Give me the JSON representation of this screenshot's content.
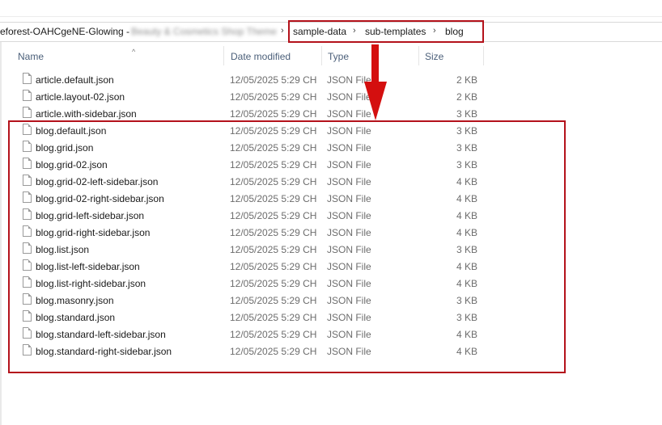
{
  "breadcrumb": {
    "first": "eforest-OAHCgeNE-Glowing -",
    "blurred": "Beauty & Cosmetics Shop Theme",
    "separator": "›",
    "items": [
      "sample-data",
      "sub-templates",
      "blog"
    ]
  },
  "columns": {
    "name": "Name",
    "date": "Date modified",
    "type": "Type",
    "size": "Size",
    "sort_indicator": "^"
  },
  "files": [
    {
      "name": "article.default.json",
      "date": "12/05/2025 5:29 CH",
      "type": "JSON File",
      "size": "2 KB"
    },
    {
      "name": "article.layout-02.json",
      "date": "12/05/2025 5:29 CH",
      "type": "JSON File",
      "size": "2 KB"
    },
    {
      "name": "article.with-sidebar.json",
      "date": "12/05/2025 5:29 CH",
      "type": "JSON File",
      "size": "3 KB"
    },
    {
      "name": "blog.default.json",
      "date": "12/05/2025 5:29 CH",
      "type": "JSON File",
      "size": "3 KB"
    },
    {
      "name": "blog.grid.json",
      "date": "12/05/2025 5:29 CH",
      "type": "JSON File",
      "size": "3 KB"
    },
    {
      "name": "blog.grid-02.json",
      "date": "12/05/2025 5:29 CH",
      "type": "JSON File",
      "size": "3 KB"
    },
    {
      "name": "blog.grid-02-left-sidebar.json",
      "date": "12/05/2025 5:29 CH",
      "type": "JSON File",
      "size": "4 KB"
    },
    {
      "name": "blog.grid-02-right-sidebar.json",
      "date": "12/05/2025 5:29 CH",
      "type": "JSON File",
      "size": "4 KB"
    },
    {
      "name": "blog.grid-left-sidebar.json",
      "date": "12/05/2025 5:29 CH",
      "type": "JSON File",
      "size": "4 KB"
    },
    {
      "name": "blog.grid-right-sidebar.json",
      "date": "12/05/2025 5:29 CH",
      "type": "JSON File",
      "size": "4 KB"
    },
    {
      "name": "blog.list.json",
      "date": "12/05/2025 5:29 CH",
      "type": "JSON File",
      "size": "3 KB"
    },
    {
      "name": "blog.list-left-sidebar.json",
      "date": "12/05/2025 5:29 CH",
      "type": "JSON File",
      "size": "4 KB"
    },
    {
      "name": "blog.list-right-sidebar.json",
      "date": "12/05/2025 5:29 CH",
      "type": "JSON File",
      "size": "4 KB"
    },
    {
      "name": "blog.masonry.json",
      "date": "12/05/2025 5:29 CH",
      "type": "JSON File",
      "size": "3 KB"
    },
    {
      "name": "blog.standard.json",
      "date": "12/05/2025 5:29 CH",
      "type": "JSON File",
      "size": "3 KB"
    },
    {
      "name": "blog.standard-left-sidebar.json",
      "date": "12/05/2025 5:29 CH",
      "type": "JSON File",
      "size": "4 KB"
    },
    {
      "name": "blog.standard-right-sidebar.json",
      "date": "12/05/2025 5:29 CH",
      "type": "JSON File",
      "size": "4 KB"
    }
  ],
  "icons": {
    "file": "json-file-icon"
  },
  "colors": {
    "highlight": "#b4121b",
    "arrow": "#d40f0f",
    "header_text": "#4c607a"
  }
}
